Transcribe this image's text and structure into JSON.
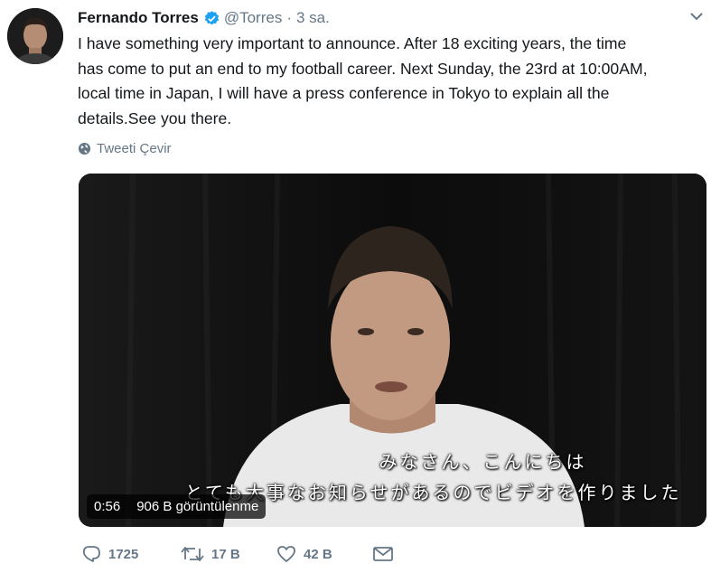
{
  "tweet": {
    "author_name": "Fernando Torres",
    "handle": "@Torres",
    "separator": "·",
    "time": "3 sa.",
    "text": "I have something very important to announce. After 18 exciting years, the time\nhas come to put an end to my football career. Next Sunday, the 23rd at 10:00AM,\nlocal time in Japan, I will have a press conference in Tokyo to explain all the\ndetails.See you there.",
    "translate_label": "Tweeti Çevir",
    "verified_icon": "verified-badge-icon",
    "colors": {
      "verified": "#1da1f2",
      "muted": "#657786",
      "text": "#14171a"
    }
  },
  "video": {
    "subtitle_line1": "みなさん、こんにちは",
    "subtitle_line2": "とても大事なお知らせがあるのでビデオを作りました",
    "duration": "0:56",
    "views": "906 B görüntülenme"
  },
  "actions": {
    "reply_count": "1725",
    "retweet_count": "17 B",
    "like_count": "42 B"
  }
}
